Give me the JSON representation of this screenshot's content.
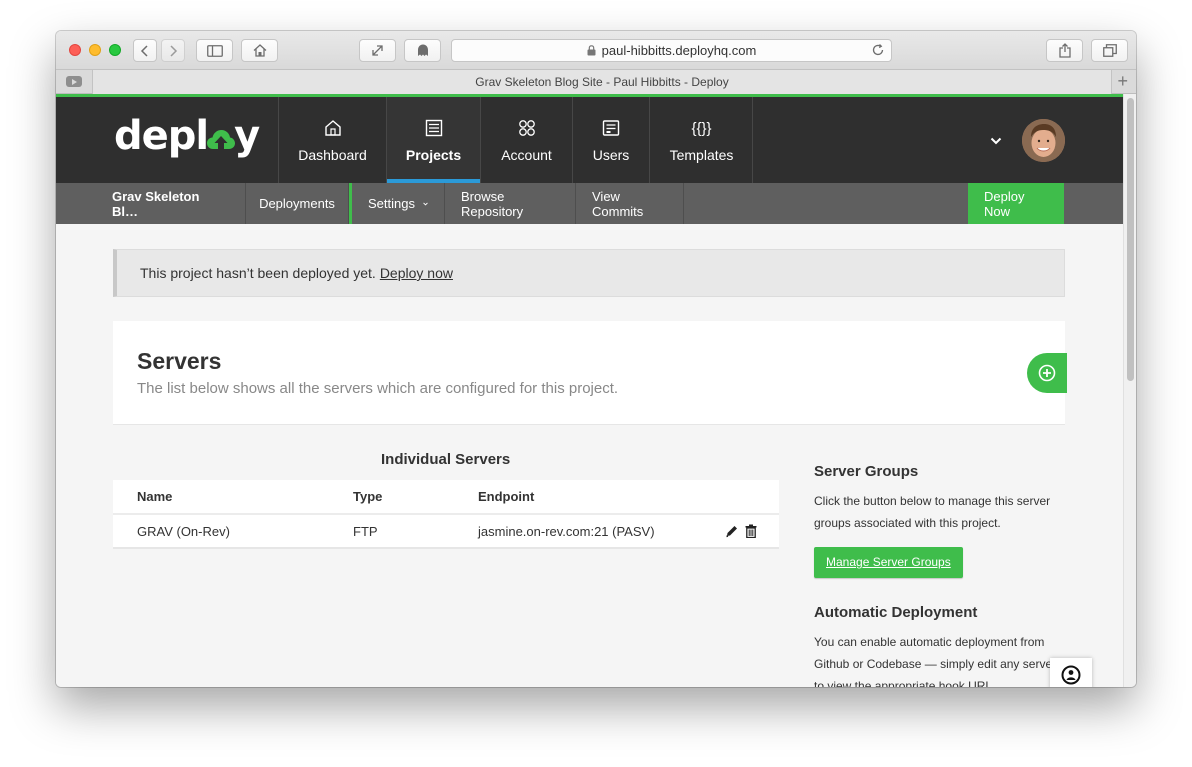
{
  "browser": {
    "url": "paul-hibbitts.deployhq.com",
    "tab_title": "Grav Skeleton Blog Site - Paul Hibbitts - Deploy",
    "new_tab": "+"
  },
  "nav": {
    "logo": {
      "left": "depl",
      "right": "y"
    },
    "items": [
      {
        "label": "Dashboard",
        "icon": "house-icon"
      },
      {
        "label": "Projects",
        "icon": "projects-icon",
        "active": true
      },
      {
        "label": "Account",
        "icon": "account-icon"
      },
      {
        "label": "Users",
        "icon": "users-icon"
      },
      {
        "label": "Templates",
        "icon": "templates-icon",
        "glyph": "{{}}"
      }
    ]
  },
  "subnav": {
    "project": "Grav Skeleton Bl…",
    "deployments": "Deployments",
    "settings": "Settings",
    "browse": "Browse Repository",
    "commits": "View Commits",
    "deploy_now": "Deploy Now"
  },
  "alert": {
    "text": "This project hasn’t been deployed yet.",
    "link": "Deploy now"
  },
  "servers": {
    "title": "Servers",
    "subtitle": "The list below shows all the servers which are configured for this project.",
    "individual_title": "Individual Servers",
    "columns": [
      "Name",
      "Type",
      "Endpoint"
    ],
    "rows": [
      {
        "name": "GRAV (On-Rev)",
        "type": "FTP",
        "endpoint": "jasmine.on-rev.com:21 (PASV)"
      }
    ]
  },
  "sidebar": {
    "groups_title": "Server Groups",
    "groups_text": "Click the button below to manage this server groups associated with this project.",
    "manage_button": "Manage Server Groups",
    "auto_title": "Automatic Deployment",
    "auto_text": "You can enable automatic deployment from Github or Codebase — simply edit any server to view the appropriate hook URL."
  },
  "colors": {
    "accent": "#3fbd4b",
    "nav_bg": "#2f2f2f",
    "subnav_bg": "#5f5f5f",
    "active_underline": "#2b9ad8"
  }
}
